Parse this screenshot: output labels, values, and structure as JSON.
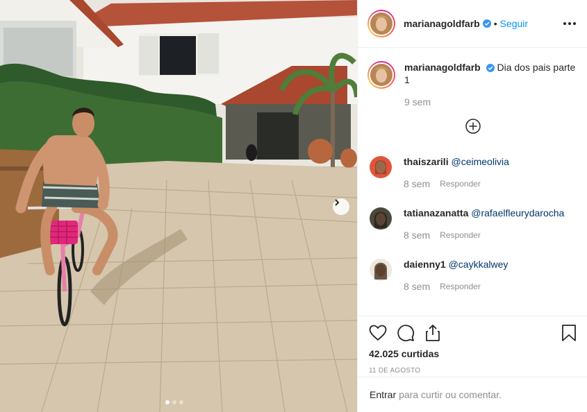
{
  "post": {
    "username": "marianagoldfarb",
    "follow_label": "Seguir",
    "separator": "•",
    "caption": "Dia dos pais parte 1",
    "caption_time": "9 sem",
    "likes": "42.025 curtidas",
    "date": "11 DE AGOSTO",
    "carousel": {
      "total_slides": 3,
      "active_slide": 1
    }
  },
  "comments": [
    {
      "username": "thaiszarili",
      "mention": "@ceimeolivia",
      "time": "8 sem",
      "reply_label": "Responder"
    },
    {
      "username": "tatianazanatta",
      "mention": "@rafaelfleurydarocha",
      "time": "8 sem",
      "reply_label": "Responder"
    },
    {
      "username": "daienny1",
      "mention": "@caykkalwey",
      "time": "8 sem",
      "reply_label": "Responder"
    }
  ],
  "login": {
    "link": "Entrar",
    "text": "para curtir ou comentar."
  },
  "icons": [
    "verified-badge-icon",
    "more-options-icon",
    "load-more-comments-icon",
    "heart-icon",
    "comment-icon",
    "share-icon",
    "bookmark-icon",
    "next-arrow-icon"
  ],
  "colors": {
    "link_blue": "#0095f6",
    "verified_blue": "#3897f0",
    "muted": "#8e8e8e",
    "border": "#efefef"
  }
}
